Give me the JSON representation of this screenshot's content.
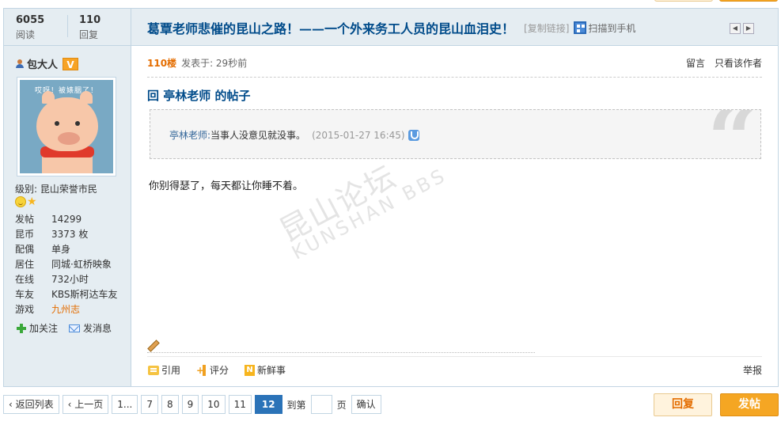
{
  "header": {
    "views_count": "6055",
    "views_label": "阅读",
    "replies_count": "110",
    "replies_label": "回复",
    "title": "葛覃老师悲催的昆山之路！——一个外来务工人员的昆山血泪史！",
    "copy_link": "[复制链接]",
    "scan_to_phone": "扫描到手机"
  },
  "user": {
    "name": "包大人",
    "verified_badge": "V",
    "avatar_caption": "哎呀！被婊胭了！",
    "level": "级别: 昆山荣誉市民",
    "profile": [
      {
        "key": "发帖",
        "value": "14299"
      },
      {
        "key": "昆币",
        "value": "3373 枚"
      },
      {
        "key": "配偶",
        "value": "单身"
      },
      {
        "key": "居住",
        "value": "同城·虹桥映象"
      },
      {
        "key": "在线",
        "value": "732小时"
      },
      {
        "key": "车友",
        "value": "KBS斯柯达车友"
      },
      {
        "key": "游戏",
        "value": "九州志"
      }
    ],
    "follow_label": "加关注",
    "message_label": "发消息"
  },
  "post": {
    "floor": "110楼",
    "posted_at": "发表于: 29秒前",
    "leave_message": "留言",
    "only_author": "只看该作者",
    "reply_title": "回 亭林老师 的帖子",
    "quote_author": "亭林老师:",
    "quote_text": "当事人没意见就没事。",
    "quote_time": "(2015-01-27 16:45)",
    "body": "你别得瑟了，每天都让你睡不着。",
    "watermark_line1": "昆山论坛",
    "watermark_line2": "KUNSHAN BBS"
  },
  "actions": {
    "quote": "引用",
    "rate": "评分",
    "new": "新鲜事",
    "report": "举报"
  },
  "pager": {
    "back": "返回列表",
    "prev": "上一页",
    "first": "1...",
    "pages": [
      "7",
      "8",
      "9",
      "10",
      "11"
    ],
    "current": "12",
    "goto_label": "到第",
    "page_unit": "页",
    "confirm": "确认"
  },
  "buttons": {
    "reply": "回复",
    "new_post": "发帖"
  },
  "colors": {
    "accent_blue": "#004b8a",
    "orange": "#e46d00",
    "panel_bg": "#e5edf2",
    "border": "#c2d5e3"
  }
}
